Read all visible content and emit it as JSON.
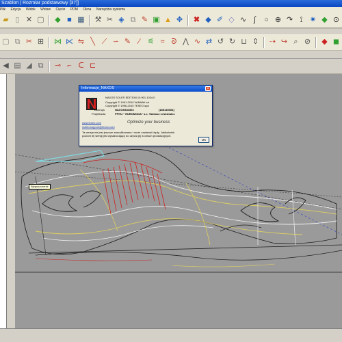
{
  "window": {
    "title": "Szablon | Rozmiar podstawowy [37]]"
  },
  "menu": [
    "Plik",
    "Edycja",
    "Widok",
    "Wstaw",
    "Cięcie",
    "PDM",
    "Okna",
    "Narzędzia systemu"
  ],
  "dialog": {
    "title": "Informacje_NAXOS",
    "edition": "NAXOS SOLES EDITION 10.901.1024.0",
    "copyright1": "Copyright © 1991-2010 VANNAK srl",
    "copyright2": "Copyright © 1996-2010 TESEO spa",
    "license_label": "Licencja",
    "license_value": "NAXOS540304",
    "license_code": "[185140304]",
    "owner_label": "Projektanta",
    "owner_value": "PPHU \" EUROMODA\" s.c. Tadeusz Leskiewicz",
    "website": "www.teseo.com",
    "email": "mailto:support@teseo.com",
    "slogan": "Optimize your business",
    "note1": "Ta wersja nie jest jeszcze zweryfikowana i może zawierać błędy. Jakikolwiek",
    "note2": "poziom tej wersji jest wystarczający do użycia jej w celach produkcyjnych.",
    "ok_label": "OK"
  },
  "tooltip": {
    "text": "Wypuszczenie"
  },
  "colors": {
    "titlebar": "#0a46c4",
    "canvas": "#9a9a9a",
    "accent_red": "#cc2222",
    "accent_yellow": "#e0d060",
    "accent_white": "#f0f0f0",
    "accent_cyan": "#80d8e0",
    "accent_blue": "#3040c0"
  }
}
